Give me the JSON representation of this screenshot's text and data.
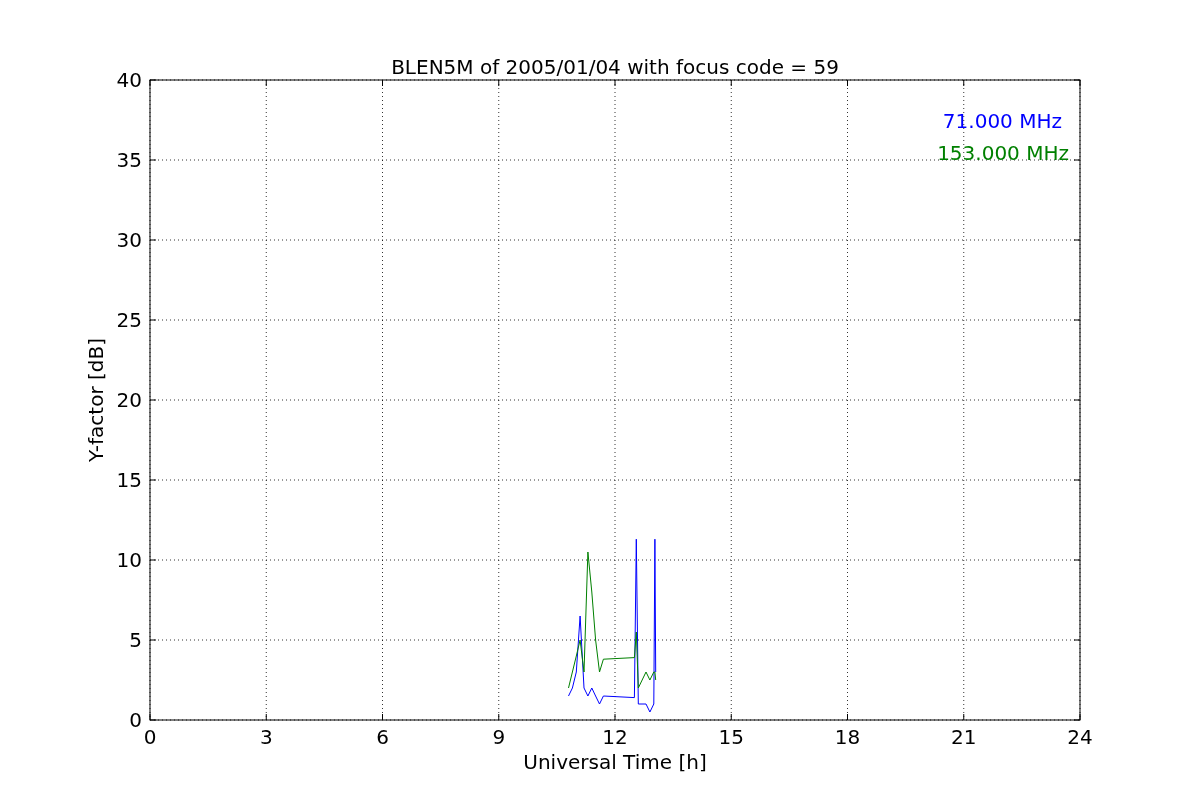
{
  "figure": {
    "chart_data": {
      "type": "line",
      "title": "BLEN5M of 2005/01/04 with focus code = 59",
      "xlabel": "Universal Time [h]",
      "ylabel": "Y-factor [dB]",
      "x": [
        10.8,
        10.9,
        11.0,
        11.1,
        11.2,
        11.3,
        11.4,
        11.5,
        11.6,
        11.7,
        12.5,
        12.55,
        12.6,
        12.8,
        12.9,
        13.0,
        13.03,
        13.05
      ],
      "series": [
        {
          "name": "71.000 MHz",
          "color": "#0000ff",
          "values": [
            1.5,
            2,
            3,
            6.5,
            2,
            1.5,
            2,
            1.5,
            1,
            1.5,
            1.4,
            11.3,
            1,
            1,
            0.5,
            1,
            11.3,
            3
          ]
        },
        {
          "name": "153.000 MHz",
          "color": "#008000",
          "values": [
            2,
            3,
            4,
            5,
            3,
            10.5,
            8,
            5,
            3,
            3.8,
            3.9,
            5.5,
            2,
            3,
            2.5,
            3,
            3,
            2.5
          ]
        }
      ],
      "xlim": [
        0,
        24
      ],
      "ylim": [
        0,
        40
      ],
      "xticks": [
        0,
        3,
        6,
        9,
        12,
        15,
        18,
        21,
        24
      ],
      "yticks": [
        0,
        5,
        10,
        15,
        20,
        25,
        30,
        35,
        40
      ],
      "grid": true
    }
  }
}
